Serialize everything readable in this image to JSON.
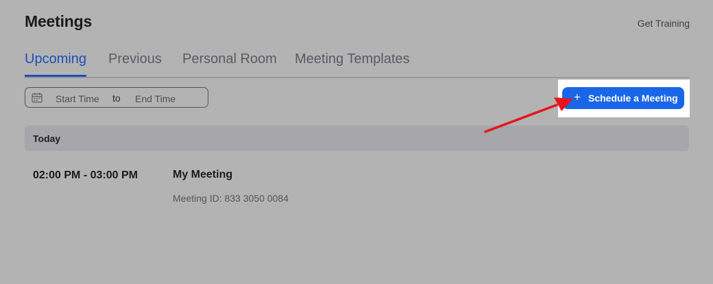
{
  "header": {
    "title": "Meetings",
    "get_training": "Get Training"
  },
  "tabs": [
    {
      "label": "Upcoming",
      "active": true
    },
    {
      "label": "Previous",
      "active": false
    },
    {
      "label": "Personal Room",
      "active": false
    },
    {
      "label": "Meeting Templates",
      "active": false
    }
  ],
  "date_range": {
    "start_placeholder": "Start Time",
    "separator": "to",
    "end_placeholder": "End Time"
  },
  "schedule_button": {
    "icon": "+",
    "label": "Schedule a Meeting"
  },
  "sections": [
    {
      "label": "Today",
      "meetings": [
        {
          "time": "02:00 PM - 03:00 PM",
          "name": "My Meeting",
          "meeting_id": "Meeting ID: 833 3050 0084"
        }
      ]
    }
  ],
  "colors": {
    "accent": "#1e4fb8",
    "button": "#1a66e8",
    "annotation_arrow": "#e8141b"
  },
  "icons": {
    "calendar": "calendar-icon",
    "plus": "plus-icon",
    "annotation": "red-arrow-icon"
  }
}
